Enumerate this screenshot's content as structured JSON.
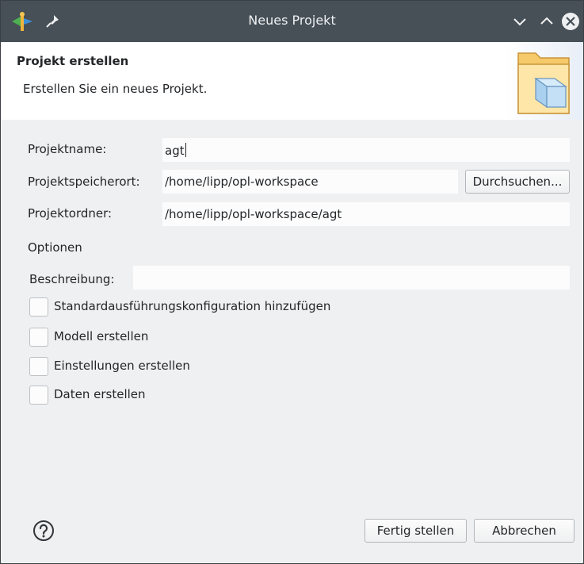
{
  "window": {
    "title": "Neues Projekt"
  },
  "banner": {
    "title": "Projekt erstellen",
    "description": "Erstellen Sie ein neues Projekt."
  },
  "form": {
    "project_name_label": "Projektname:",
    "project_name_value": "agt",
    "location_label": "Projektspeicherort:",
    "location_value": "/home/lipp/opl-workspace",
    "browse_label": "Durchsuchen...",
    "folder_label": "Projektordner:",
    "folder_value": "/home/lipp/opl-workspace/agt",
    "options_label": "Optionen",
    "description_label": "Beschreibung:",
    "description_value": ""
  },
  "options": [
    {
      "label": "Standardausführungskonfiguration hinzufügen",
      "checked": false
    },
    {
      "label": "Modell erstellen",
      "checked": false
    },
    {
      "label": "Einstellungen erstellen",
      "checked": false
    },
    {
      "label": "Daten erstellen",
      "checked": false
    }
  ],
  "footer": {
    "finish_label": "Fertig stellen",
    "cancel_label": "Abbrechen"
  },
  "icons": {
    "app": "eclipse-app-icon",
    "pin": "pin-icon",
    "minimize": "chevron-down-icon",
    "maximize": "chevron-up-icon",
    "close": "close-icon",
    "banner": "project-folder-cube-icon",
    "help": "help-icon"
  },
  "colors": {
    "titlebar": "#475057",
    "window_bg": "#eff0f1",
    "field_bg": "#fcfcfc",
    "close_button": "#eff0f1"
  }
}
